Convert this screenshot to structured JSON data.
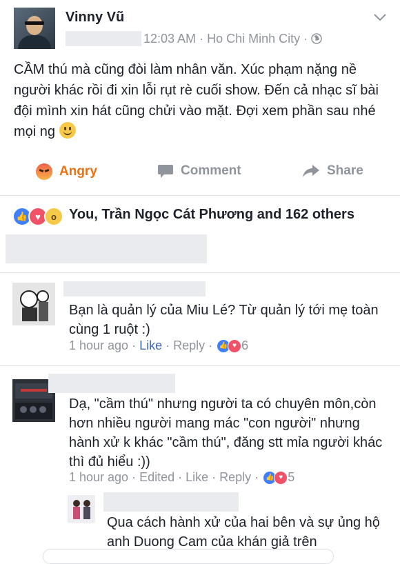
{
  "post": {
    "author": "Vinny Vũ",
    "time": "12:03 AM",
    "location": "Ho Chi Minh City",
    "text": "CẦM thú mà cũng đòi làm nhân văn. Xúc phạm nặng nề người khác rồi đi xin lỗi rụt rè cuối show. Đến cả nhạc sĩ bài đội mình xin hát cũng chửi vào mặt. Đợi xem phần sau nhé mọi ng"
  },
  "actions": {
    "angry_label": "Angry",
    "comment_label": "Comment",
    "share_label": "Share"
  },
  "reactions": {
    "summary": "You, Trần Ngọc Cát Phương and 162 others"
  },
  "comments": [
    {
      "text": "Bạn là quản lý của Miu Lé? Từ quản lý tới mẹ toàn cùng 1 ruột :)",
      "time": "1 hour ago",
      "like": "Like",
      "reply": "Reply",
      "count": "6"
    },
    {
      "text": "Dạ, \"cầm thú\" nhưng người ta có chuyên môn,còn hơn nhiều người mang mác \"con người\" nhưng hành xử k khác \"cầm thú\", đăng stt mỉa người khác thì đủ hiểu :))",
      "time": "1 hour ago",
      "edited": "Edited",
      "like": "Like",
      "reply": "Reply",
      "count": "5"
    },
    {
      "text": "Qua cách hành xử của hai bên và sự ủng hộ anh Duong Cam của khán giả trên"
    }
  ],
  "colors": {
    "link": "#4267b2",
    "muted": "#90949c",
    "angry": "#e9710f",
    "text": "#1d2129"
  }
}
